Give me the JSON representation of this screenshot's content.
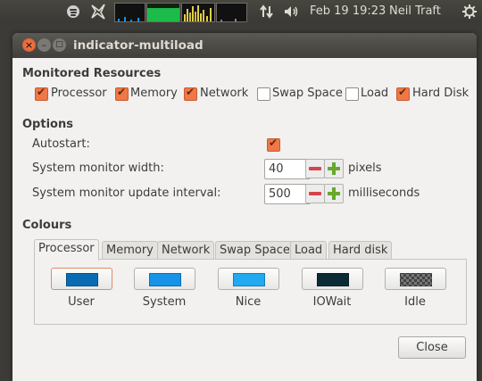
{
  "panel": {
    "datetime": "Feb 19 19:23",
    "user": "Neil Traft",
    "icons": [
      "spotify-icon",
      "messaging-icon",
      "system-monitor-graphs",
      "network-updown-icon",
      "volume-icon",
      "power-gear-icon"
    ]
  },
  "window": {
    "title": "indicator-multiload",
    "monitored_heading": "Monitored Resources",
    "resources": [
      {
        "label": "Processor",
        "checked": true
      },
      {
        "label": "Memory",
        "checked": true
      },
      {
        "label": "Network",
        "checked": true
      },
      {
        "label": "Swap Space",
        "checked": false
      },
      {
        "label": "Load",
        "checked": false
      },
      {
        "label": "Hard Disk",
        "checked": true
      }
    ],
    "options_heading": "Options",
    "autostart_label": "Autostart:",
    "autostart_checked": true,
    "width_label": "System monitor width:",
    "width_value": "40",
    "width_unit": "pixels",
    "interval_label": "System monitor update interval:",
    "interval_value": "500",
    "interval_unit": "milliseconds",
    "colours_heading": "Colours",
    "tabs": [
      "Processor",
      "Memory",
      "Network",
      "Swap Space",
      "Load",
      "Hard disk"
    ],
    "active_tab": "Processor",
    "colours": [
      {
        "label": "User",
        "color": "#0a6bb3"
      },
      {
        "label": "System",
        "color": "#1593e6"
      },
      {
        "label": "Nice",
        "color": "#23a9f0"
      },
      {
        "label": "IOWait",
        "color": "#0c2a35"
      },
      {
        "label": "Idle",
        "color": "checkered"
      }
    ],
    "close_label": "Close"
  }
}
